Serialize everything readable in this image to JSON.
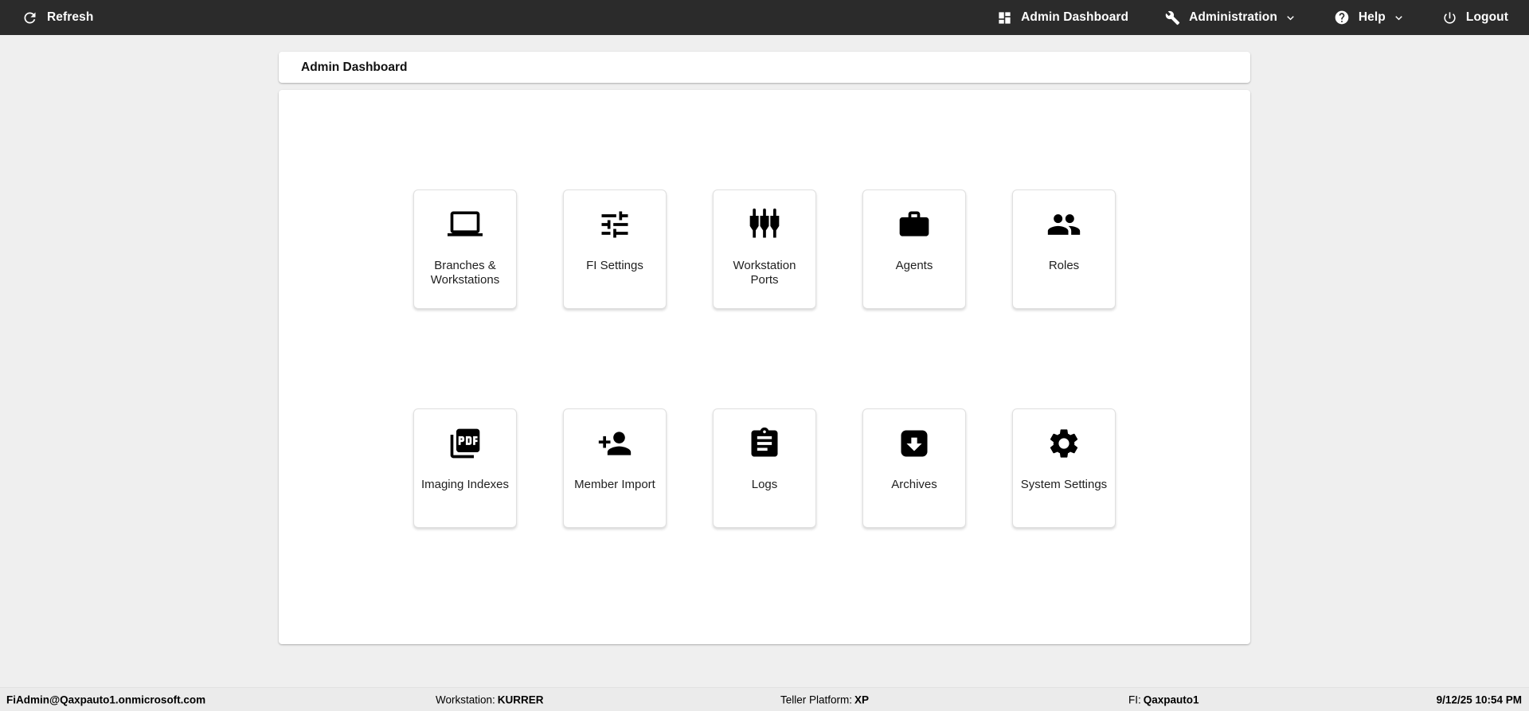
{
  "topbar": {
    "refresh_label": "Refresh",
    "nav": [
      {
        "label": "Admin Dashboard",
        "icon": "dashboard-icon",
        "has_chevron": false
      },
      {
        "label": "Administration",
        "icon": "wrench-icon",
        "has_chevron": true
      },
      {
        "label": "Help",
        "icon": "help-icon",
        "has_chevron": true
      },
      {
        "label": "Logout",
        "icon": "power-icon",
        "has_chevron": false
      }
    ]
  },
  "page": {
    "title": "Admin Dashboard"
  },
  "tiles": {
    "row1": [
      {
        "label": "Branches & Workstations",
        "icon": "laptop-icon"
      },
      {
        "label": "FI Settings",
        "icon": "sliders-icon"
      },
      {
        "label": "Workstation Ports",
        "icon": "ports-icon"
      },
      {
        "label": "Agents",
        "icon": "briefcase-icon"
      },
      {
        "label": "Roles",
        "icon": "people-icon"
      }
    ],
    "row2": [
      {
        "label": "Imaging Indexes",
        "icon": "pdf-icon"
      },
      {
        "label": "Member Import",
        "icon": "person-add-icon"
      },
      {
        "label": "Logs",
        "icon": "clipboard-icon"
      },
      {
        "label": "Archives",
        "icon": "archive-icon"
      },
      {
        "label": "System Settings",
        "icon": "gear-icon"
      }
    ]
  },
  "statusbar": {
    "user": "FiAdmin@Qaxpauto1.onmicrosoft.com",
    "workstation_label": "Workstation:",
    "workstation_value": "KURRER",
    "teller_platform_label": "Teller Platform:",
    "teller_platform_value": "XP",
    "fi_label": "FI:",
    "fi_value": "Qaxpauto1",
    "datetime": "9/12/25 10:54 PM"
  },
  "colors": {
    "topbar_bg": "#2b2b2b",
    "topbar_text": "#ffffff",
    "page_bg": "#efefef",
    "card_bg": "#ffffff",
    "statusbar_bg": "#ebebeb",
    "icon_color": "#000000"
  }
}
